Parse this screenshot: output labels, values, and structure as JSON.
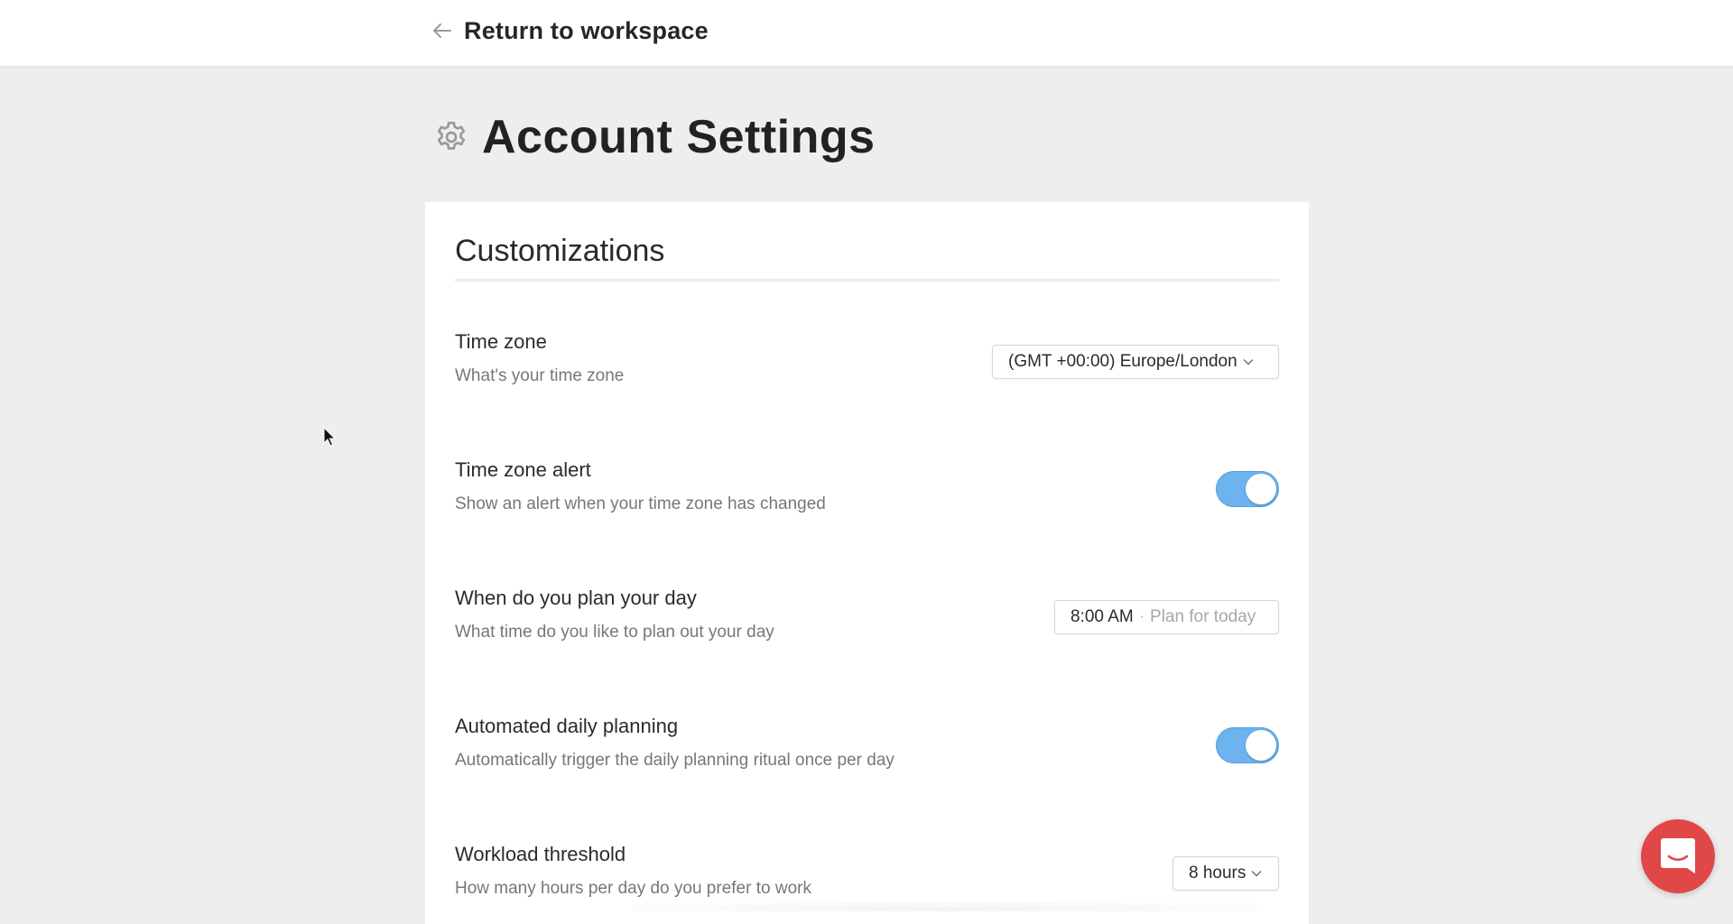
{
  "header": {
    "back_icon": "arrow-left-icon",
    "back_label": "Return to workspace"
  },
  "page": {
    "icon": "gear-icon",
    "title": "Account Settings"
  },
  "section": {
    "title": "Customizations"
  },
  "settings": [
    {
      "label": "Time zone",
      "description": "What's your time zone",
      "control": "select",
      "value": "(GMT +00:00) Europe/London"
    },
    {
      "label": "Time zone alert",
      "description": "Show an alert when your time zone has changed",
      "control": "toggle",
      "value": "on"
    },
    {
      "label": "When do you plan your day",
      "description": "What time do you like to plan out your day",
      "control": "time",
      "value": "8:00 AM",
      "separator": "·",
      "hint": "Plan for today"
    },
    {
      "label": "Automated daily planning",
      "description": "Automatically trigger the daily planning ritual once per day",
      "control": "toggle",
      "value": "on"
    },
    {
      "label": "Workload threshold",
      "description": "How many hours per day do you prefer to work",
      "control": "select",
      "value": "8 hours"
    }
  ],
  "chat_launcher": {
    "icon": "chat-bubble-icon"
  },
  "colors": {
    "toggle_on": "#6cb3ef",
    "chat_launcher": "#e04848",
    "background": "#eeeeee"
  }
}
